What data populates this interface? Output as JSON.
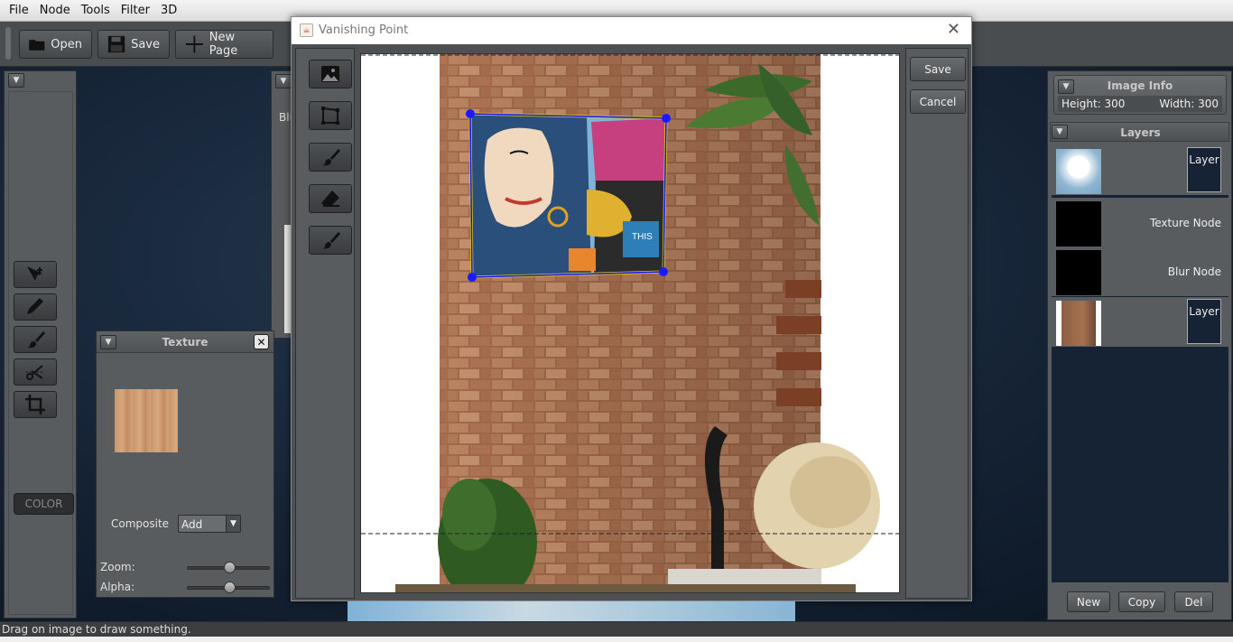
{
  "menu": [
    "File",
    "Node",
    "Tools",
    "Filter",
    "3D"
  ],
  "toolbar": {
    "open_label": "Open",
    "save_label": "Save",
    "new_page_label": "New Page"
  },
  "left_tools": {
    "tools": [
      "select-move-icon",
      "pencil-icon",
      "brush-icon",
      "scissors-icon",
      "crop-icon"
    ],
    "color_label": "COLOR"
  },
  "behind_window": {
    "label": "Blu"
  },
  "texture_panel": {
    "title": "Texture",
    "composite_label": "Composite",
    "composite_value": "Add",
    "zoom_label": "Zoom:",
    "alpha_label": "Alpha:",
    "zoom_value": 0.5,
    "alpha_value": 0.5
  },
  "dialog": {
    "title": "Vanishing Point",
    "save_label": "Save",
    "cancel_label": "Cancel",
    "tools": [
      "image-icon",
      "perspective-plane-icon",
      "brush-icon",
      "eraser-icon",
      "brush-alt-icon"
    ]
  },
  "image_info": {
    "title": "Image Info",
    "height_label": "Height: 300",
    "width_label": "Width: 300"
  },
  "layers": {
    "title": "Layers",
    "items": [
      {
        "label": "Layer",
        "thumb": "dandelion"
      },
      {
        "label": "Texture Node",
        "thumb": "black"
      },
      {
        "label": "Blur Node",
        "thumb": "black"
      },
      {
        "label": "Layer",
        "thumb": "brick-wall"
      }
    ],
    "new_label": "New",
    "copy_label": "Copy",
    "del_label": "Del"
  },
  "status": {
    "text": "Drag on image to draw something."
  }
}
